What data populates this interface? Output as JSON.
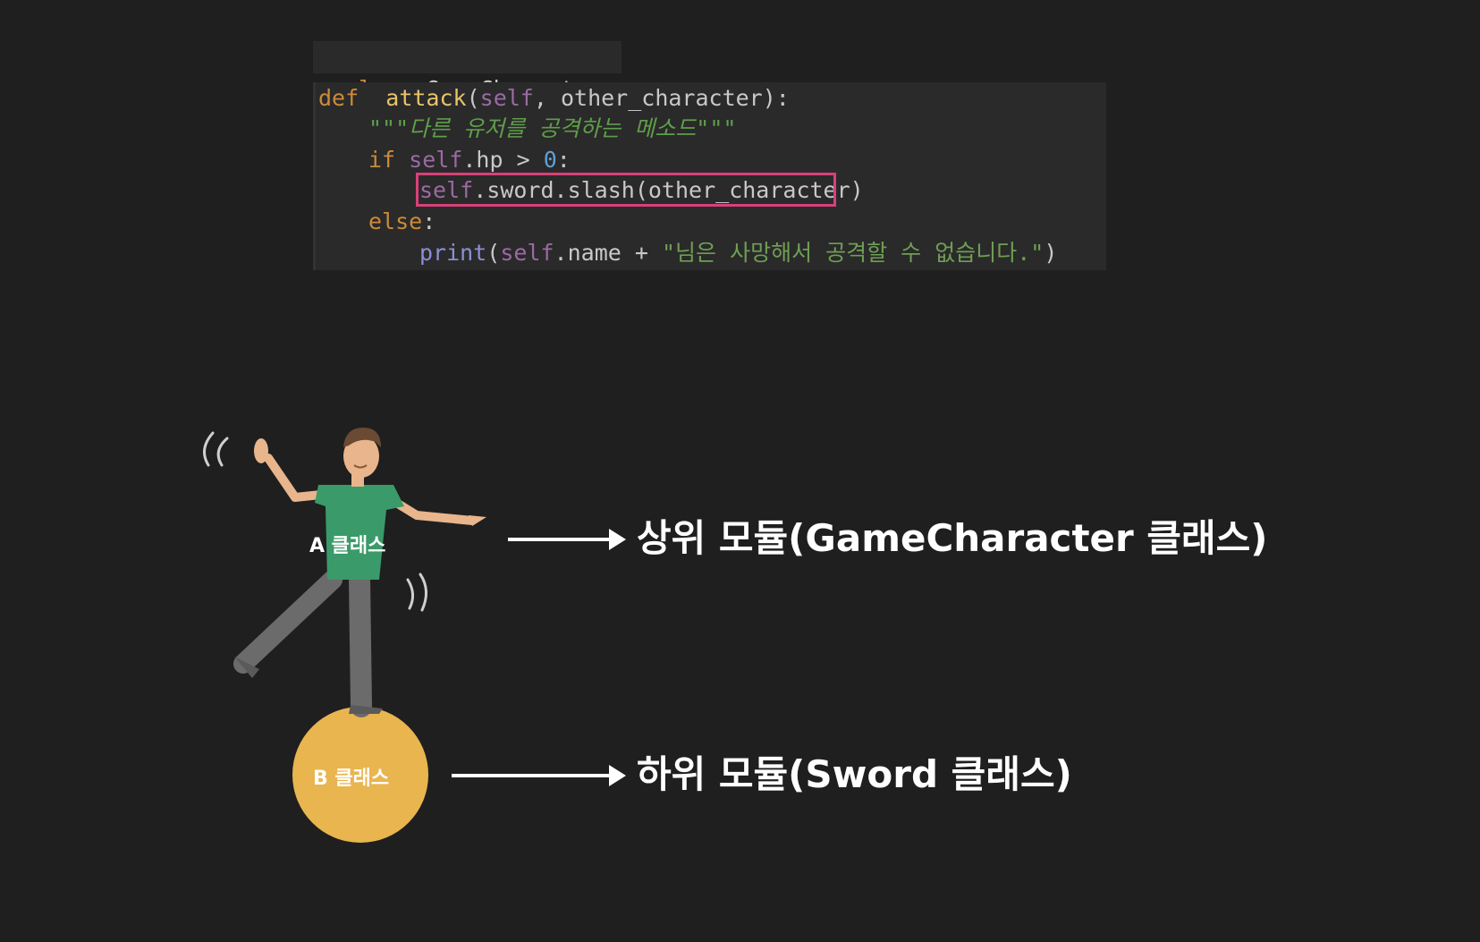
{
  "code": {
    "class_line": "class GameCharacter:",
    "lines": [
      [
        "def ",
        " attack",
        "(",
        "self",
        ", other_character):"
      ],
      [
        "\"\"\"다른 유저를 공격하는 메소드\"\"\""
      ],
      [
        "if ",
        "self",
        ".hp > ",
        "0",
        ":"
      ],
      [
        "self",
        ".sword.slash(other_character)"
      ],
      [
        "else",
        ":"
      ],
      [
        "print",
        "(",
        "self",
        ".name + ",
        "\"님은 사망해서 공격할 수 없습니다.\"",
        ")"
      ]
    ]
  },
  "diagram": {
    "character_label": "A 클래스",
    "ball_label": "B 클래스",
    "upper_module_label": "상위 모듈(GameCharacter 클래스)",
    "lower_module_label": "하위 모듈(Sword 클래스)"
  },
  "colors": {
    "background": "#1f1f1f",
    "highlight_box": "#d9407a",
    "shirt": "#3a9a6a",
    "pants": "#6b6b6b",
    "ball": "#e9b54f"
  }
}
